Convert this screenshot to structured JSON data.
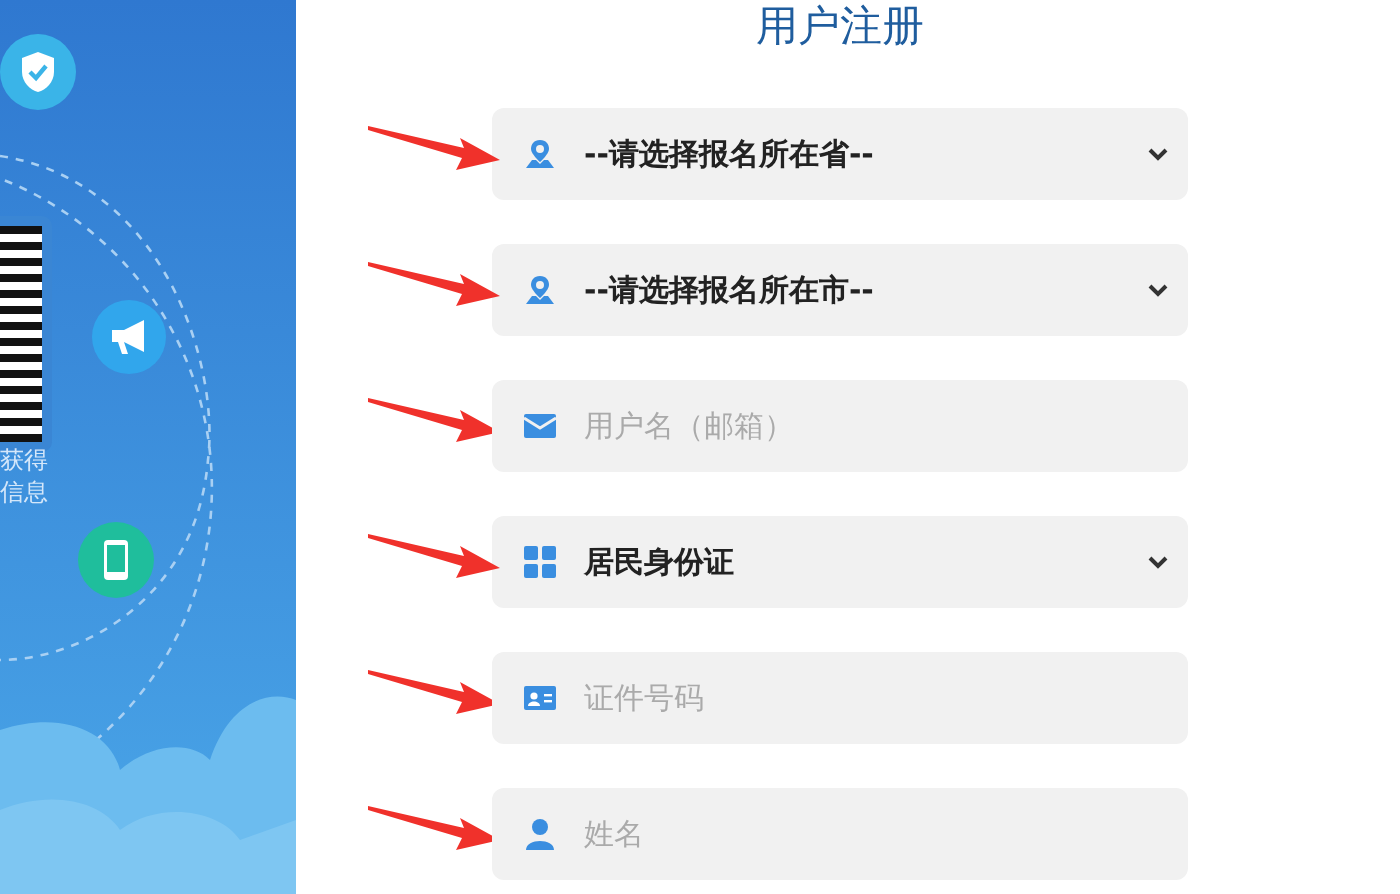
{
  "side_panel": {
    "caption_lines": [
      "获得",
      "信息"
    ]
  },
  "form": {
    "title": "用户注册",
    "fields": [
      {
        "kind": "select",
        "value": "--请选择报名所在省--"
      },
      {
        "kind": "select",
        "value": "--请选择报名所在市--"
      },
      {
        "kind": "input",
        "placeholder": "用户名（邮箱）"
      },
      {
        "kind": "select",
        "value": "居民身份证"
      },
      {
        "kind": "input",
        "placeholder": "证件号码"
      },
      {
        "kind": "input",
        "placeholder": "姓名"
      }
    ]
  }
}
